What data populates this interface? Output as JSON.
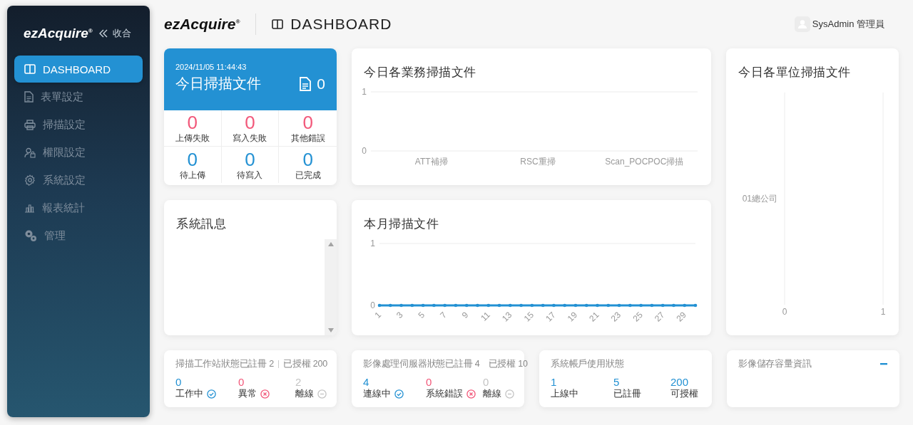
{
  "sidebar": {
    "logo": "ezAcquire$^{®}$",
    "collapse_label": "收合",
    "items": [
      {
        "label": "DASHBOARD",
        "selected": true
      },
      {
        "label": "表單設定",
        "selected": false
      },
      {
        "label": "掃描設定",
        "selected": false
      },
      {
        "label": "權限設定",
        "selected": false
      },
      {
        "label": "系統設定",
        "selected": false
      },
      {
        "label": "報表統計",
        "selected": false
      },
      {
        "label": "管理",
        "selected": false
      }
    ]
  },
  "header": {
    "logo": "ezAcquire$^{®}$",
    "title": "DASHBOARD",
    "user": "SysAdmin 管理員"
  },
  "today_card": {
    "timestamp": "2024/11/05 11:44:43",
    "title": "今日掃描文件",
    "count": "0",
    "stats": [
      {
        "value": "0",
        "label": "上傳失敗",
        "kind": "error"
      },
      {
        "value": "0",
        "label": "寫入失敗",
        "kind": "error"
      },
      {
        "value": "0",
        "label": "其他錯誤",
        "kind": "error"
      },
      {
        "value": "0",
        "label": "待上傳",
        "kind": "info"
      },
      {
        "value": "0",
        "label": "待寫入",
        "kind": "info"
      },
      {
        "value": "0",
        "label": "已完成",
        "kind": "info"
      }
    ]
  },
  "business_chart": {
    "title": "今日各業務掃描文件",
    "chart_data": {
      "type": "bar",
      "categories": [
        "ATT補掃",
        "RSC重掃",
        "Scan_POCPOC掃描"
      ],
      "values": [
        0,
        0,
        0
      ],
      "ylim": [
        0,
        1
      ],
      "yticks": [
        0,
        1
      ]
    }
  },
  "unit_chart": {
    "title": "今日各單位掃描文件",
    "chart_data": {
      "type": "bar",
      "orientation": "horizontal",
      "categories": [
        "01總公司"
      ],
      "values": [
        0
      ],
      "xlim": [
        0,
        1
      ],
      "xticks": [
        0,
        1
      ]
    }
  },
  "messages": {
    "title": "系統訊息"
  },
  "monthly_chart": {
    "title": "本月掃描文件",
    "chart_data": {
      "type": "line",
      "x": [
        1,
        2,
        3,
        4,
        5,
        6,
        7,
        8,
        9,
        10,
        11,
        12,
        13,
        14,
        15,
        16,
        17,
        18,
        19,
        20,
        21,
        22,
        23,
        24,
        25,
        26,
        27,
        28,
        29,
        30
      ],
      "series": [
        {
          "color": "#2391d3",
          "values": [
            0,
            0,
            0,
            0,
            0,
            0,
            0,
            0,
            0,
            0,
            0,
            0,
            0,
            0,
            0,
            0,
            0,
            0,
            0,
            0,
            0,
            0,
            0,
            0,
            0,
            0,
            0,
            0,
            0,
            0
          ]
        }
      ],
      "xlim": [
        1,
        30
      ],
      "ylim": [
        0,
        1
      ],
      "yticks": [
        0,
        1
      ],
      "xticks": [
        1,
        3,
        5,
        7,
        9,
        11,
        13,
        15,
        17,
        19,
        21,
        23,
        25,
        27,
        29
      ]
    }
  },
  "status_panels": [
    {
      "title": "掃描工作站狀態已註冊 2",
      "licensed": "已授權 200",
      "items": [
        {
          "value": "0",
          "label": "工作中",
          "kind": "ok"
        },
        {
          "value": "0",
          "label": "異常",
          "kind": "error"
        },
        {
          "value": "2",
          "label": "離線",
          "kind": "offline"
        }
      ]
    },
    {
      "title": "影像處理伺服器狀態已註冊 4",
      "licensed": "已授權 10",
      "items": [
        {
          "value": "4",
          "label": "連線中",
          "kind": "ok"
        },
        {
          "value": "0",
          "label": "系統錯誤",
          "kind": "error"
        },
        {
          "value": "0",
          "label": "離線",
          "kind": "offline"
        }
      ]
    },
    {
      "title": "系統帳戶使用狀態",
      "items": [
        {
          "value": "1",
          "label": "上線中",
          "kind": "plain"
        },
        {
          "value": "5",
          "label": "已註冊",
          "kind": "plain"
        },
        {
          "value": "200",
          "label": "可授權",
          "kind": "plain"
        }
      ]
    }
  ],
  "storage_panel": {
    "title": "影像儲存容量資訊"
  }
}
